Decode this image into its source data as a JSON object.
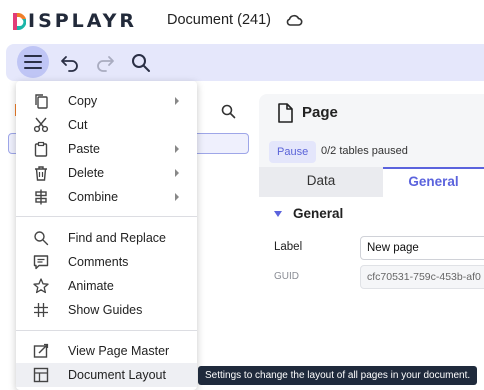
{
  "app": {
    "logo_text": "ISPLAYR",
    "document_title": "Document (241)"
  },
  "colors": {
    "accent": "#5b63dd",
    "toolbar_bg": "#e5e7fb",
    "logo_pink": "#e23c78",
    "logo_orange": "#f07f2a",
    "logo_teal": "#1bb5a8"
  },
  "toolbar": {
    "icons": [
      "menu-icon",
      "undo-icon",
      "redo-icon",
      "search-icon"
    ]
  },
  "panel": {
    "title": "Page",
    "pause_label": "Pause",
    "paused_status": "0/2 tables paused",
    "tabs": [
      {
        "label": "Data",
        "active": false
      },
      {
        "label": "General",
        "active": true
      }
    ],
    "section_title": "General",
    "fields": {
      "label_caption": "Label",
      "label_value": "New page",
      "guid_caption": "GUID",
      "guid_value": "cfc70531-759c-453b-af0"
    }
  },
  "menu": {
    "items": [
      {
        "label": "Copy",
        "icon": "copy-icon",
        "submenu": true
      },
      {
        "label": "Cut",
        "icon": "scissors-icon",
        "submenu": false
      },
      {
        "label": "Paste",
        "icon": "clipboard-icon",
        "submenu": true
      },
      {
        "label": "Delete",
        "icon": "trash-icon",
        "submenu": true
      },
      {
        "label": "Combine",
        "icon": "combine-icon",
        "submenu": true
      },
      {
        "label": "Find and Replace",
        "icon": "search-icon",
        "submenu": false
      },
      {
        "label": "Comments",
        "icon": "comment-icon",
        "submenu": false
      },
      {
        "label": "Animate",
        "icon": "star-icon",
        "submenu": false
      },
      {
        "label": "Show Guides",
        "icon": "grid-icon",
        "submenu": false
      },
      {
        "label": "View Page Master",
        "icon": "page-master-icon",
        "submenu": false
      },
      {
        "label": "Document Layout",
        "icon": "layout-icon",
        "submenu": false,
        "hovered": true
      }
    ]
  },
  "tooltip": {
    "text": "Settings to change the layout of all pages in your document."
  }
}
